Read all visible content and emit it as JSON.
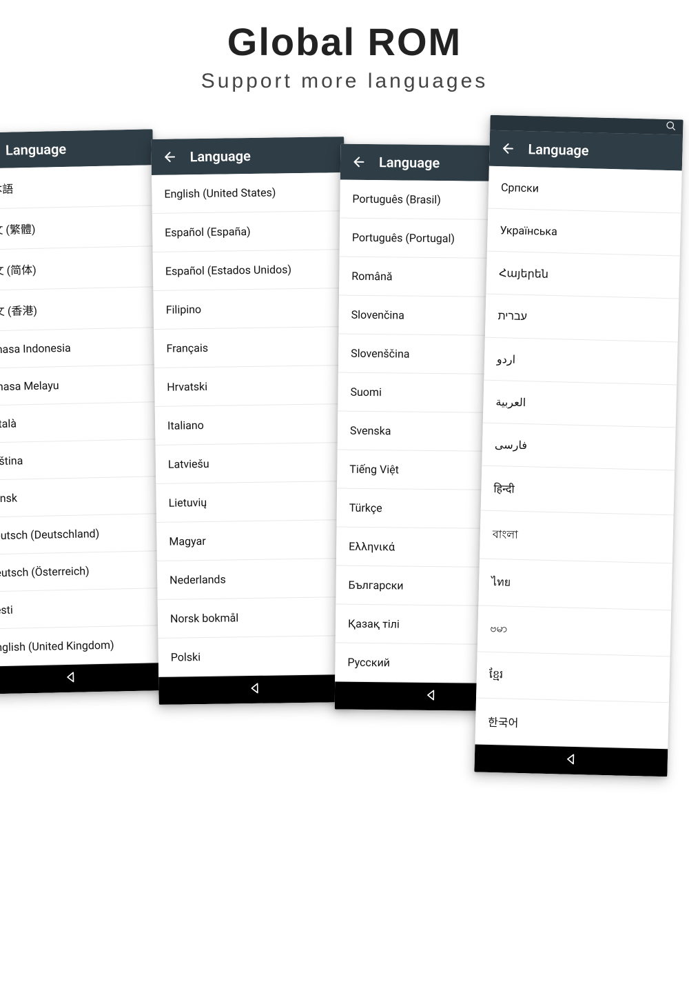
{
  "headline": {
    "title": "Global ROM",
    "subtitle": "Support more languages"
  },
  "appbar_title": "Language",
  "phones": [
    {
      "show_statusbar": false,
      "items": [
        "日本語",
        "中文 (繁體)",
        "中文 (简体)",
        "中文 (香港)",
        "Bahasa Indonesia",
        "Bahasa Melayu",
        "Català",
        "Čeština",
        "Dansk",
        "Deutsch (Deutschland)",
        "Deutsch (Österreich)",
        "Eesti",
        "English (United Kingdom)"
      ]
    },
    {
      "show_statusbar": false,
      "items": [
        "English (United States)",
        "Español (España)",
        "Español (Estados Unidos)",
        "Filipino",
        "Français",
        "Hrvatski",
        "Italiano",
        "Latviešu",
        "Lietuvių",
        "Magyar",
        "Nederlands",
        "Norsk bokmål",
        "Polski"
      ]
    },
    {
      "show_statusbar": false,
      "items": [
        "Português (Brasil)",
        "Português (Portugal)",
        "Română",
        "Slovenčina",
        "Slovenščina",
        "Suomi",
        "Svenska",
        "Tiếng Việt",
        "Türkçe",
        "Ελληνικά",
        "Български",
        "Қазақ тілі",
        "Русский"
      ]
    },
    {
      "show_statusbar": true,
      "items": [
        "Српски",
        "Українська",
        "Հայերեն",
        "עברית",
        "اردو",
        "العربية",
        "فارسی",
        "हिन्दी",
        "বাংলা",
        "ไทย",
        "ဗမာ",
        "ខ្មែរ",
        "한국어"
      ]
    }
  ]
}
